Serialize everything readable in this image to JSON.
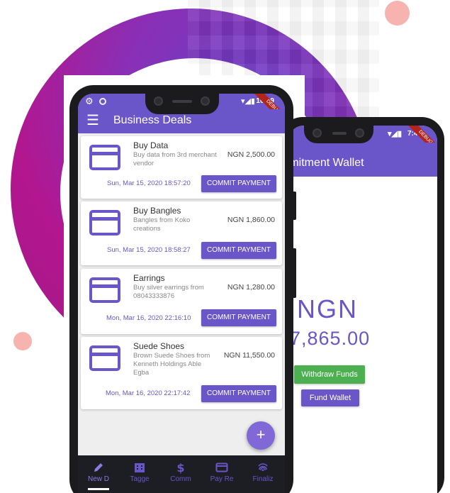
{
  "colors": {
    "primary": "#6a55c9",
    "green": "#4caf50",
    "accent_dot": "#f7b3b0",
    "blob_purple": "#8a2fb5",
    "blob_magenta": "#b3168f",
    "nav_bg": "#1d1d24"
  },
  "back_phone": {
    "status_time": "7:40",
    "debug_label": "DEBUG",
    "title": "mmitment Wallet",
    "currency": "NGN",
    "amount": "7,865.00",
    "withdraw_label": "Withdraw Funds",
    "fund_label": "Fund Wallet"
  },
  "front_phone": {
    "status_time": "10:19",
    "debug_label": "DEBUG",
    "title": "Business Deals",
    "menu_icon": "hamburger-menu-icon",
    "deals": [
      {
        "title": "Buy Data",
        "description": "Buy data from 3rd merchant vendor",
        "amount": "NGN 2,500.00",
        "date": "Sun, Mar 15, 2020 18:57:20",
        "action": "COMMIT PAYMENT"
      },
      {
        "title": "Buy Bangles",
        "description": "Bangles from Koko creations",
        "amount": "NGN 1,860.00",
        "date": "Sun, Mar 15, 2020 18:58:27",
        "action": "COMMIT PAYMENT"
      },
      {
        "title": "Earrings",
        "description": "Buy silver earrings from 08043333876",
        "amount": "NGN 1,280.00",
        "date": "Mon, Mar 16, 2020 22:16:10",
        "action": "COMMIT PAYMENT"
      },
      {
        "title": "Suede Shoes",
        "description": "Brown Suede Shoes from Kenneth Holdings Able Egba",
        "amount": "NGN 11,550.00",
        "date": "Mon, Mar 16, 2020 22:17:42",
        "action": "COMMIT PAYMENT"
      }
    ],
    "fab_label": "+",
    "nav": [
      {
        "label": "New D",
        "icon": "pencil-icon",
        "active": true
      },
      {
        "label": "Tagge",
        "icon": "building-icon",
        "active": false
      },
      {
        "label": "Comm",
        "icon": "dollar-icon",
        "active": false
      },
      {
        "label": "Pay Re",
        "icon": "credit-card-icon",
        "active": false
      },
      {
        "label": "Finaliz",
        "icon": "fingerprint-icon",
        "active": false
      }
    ]
  }
}
